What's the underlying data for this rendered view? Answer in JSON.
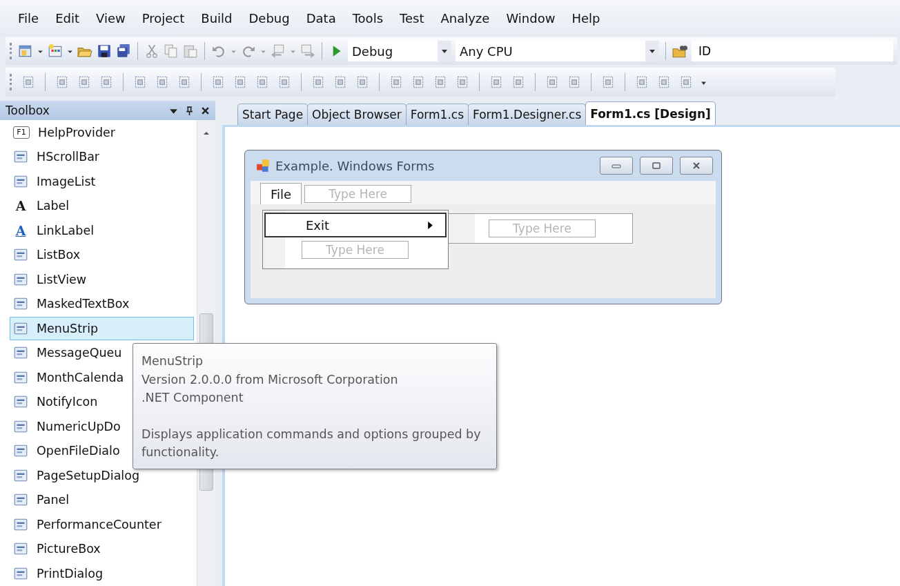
{
  "menu_bar": [
    "File",
    "Edit",
    "View",
    "Project",
    "Build",
    "Debug",
    "Data",
    "Tools",
    "Test",
    "Analyze",
    "Window",
    "Help"
  ],
  "standard_toolbar": {
    "configuration": "Debug",
    "platform": "Any CPU",
    "find_value": "ID"
  },
  "toolbox": {
    "title": "Toolbox",
    "items": [
      {
        "label": "HelpProvider",
        "badge": "F1",
        "selected": false
      },
      {
        "label": "HScrollBar",
        "selected": false
      },
      {
        "label": "ImageList",
        "selected": false
      },
      {
        "label": "Label",
        "badge": "A",
        "selected": false
      },
      {
        "label": "LinkLabel",
        "badge": "A",
        "selected": false
      },
      {
        "label": "ListBox",
        "selected": false
      },
      {
        "label": "ListView",
        "selected": false
      },
      {
        "label": "MaskedTextBox",
        "selected": false
      },
      {
        "label": "MenuStrip",
        "selected": true
      },
      {
        "label": "MessageQueu",
        "selected": false
      },
      {
        "label": "MonthCalenda",
        "selected": false
      },
      {
        "label": "NotifyIcon",
        "selected": false
      },
      {
        "label": "NumericUpDo",
        "selected": false
      },
      {
        "label": "OpenFileDialo",
        "selected": false
      },
      {
        "label": "PageSetupDialog",
        "selected": false
      },
      {
        "label": "Panel",
        "selected": false
      },
      {
        "label": "PerformanceCounter",
        "selected": false
      },
      {
        "label": "PictureBox",
        "selected": false
      },
      {
        "label": "PrintDialog",
        "selected": false
      }
    ]
  },
  "tooltip": {
    "title": "MenuStrip",
    "version": "Version 2.0.0.0 from Microsoft Corporation",
    "kind": ".NET Component",
    "description": "Displays application commands and options grouped by functionality."
  },
  "tabs": [
    {
      "label": "Start Page",
      "selected": false
    },
    {
      "label": "Object Browser",
      "selected": false
    },
    {
      "label": "Form1.cs",
      "selected": false
    },
    {
      "label": "Form1.Designer.cs",
      "selected": false
    },
    {
      "label": "Form1.cs [Design]",
      "selected": true
    }
  ],
  "form": {
    "title": "Example. Windows Forms",
    "menu": [
      {
        "label": "File",
        "selected": true
      }
    ],
    "menu_placeholder": "Type Here",
    "dropdown": [
      {
        "label": "Exit",
        "selected": true
      }
    ],
    "dropdown_placeholder": "Type Here",
    "submenu_placeholder": "Type Here"
  }
}
